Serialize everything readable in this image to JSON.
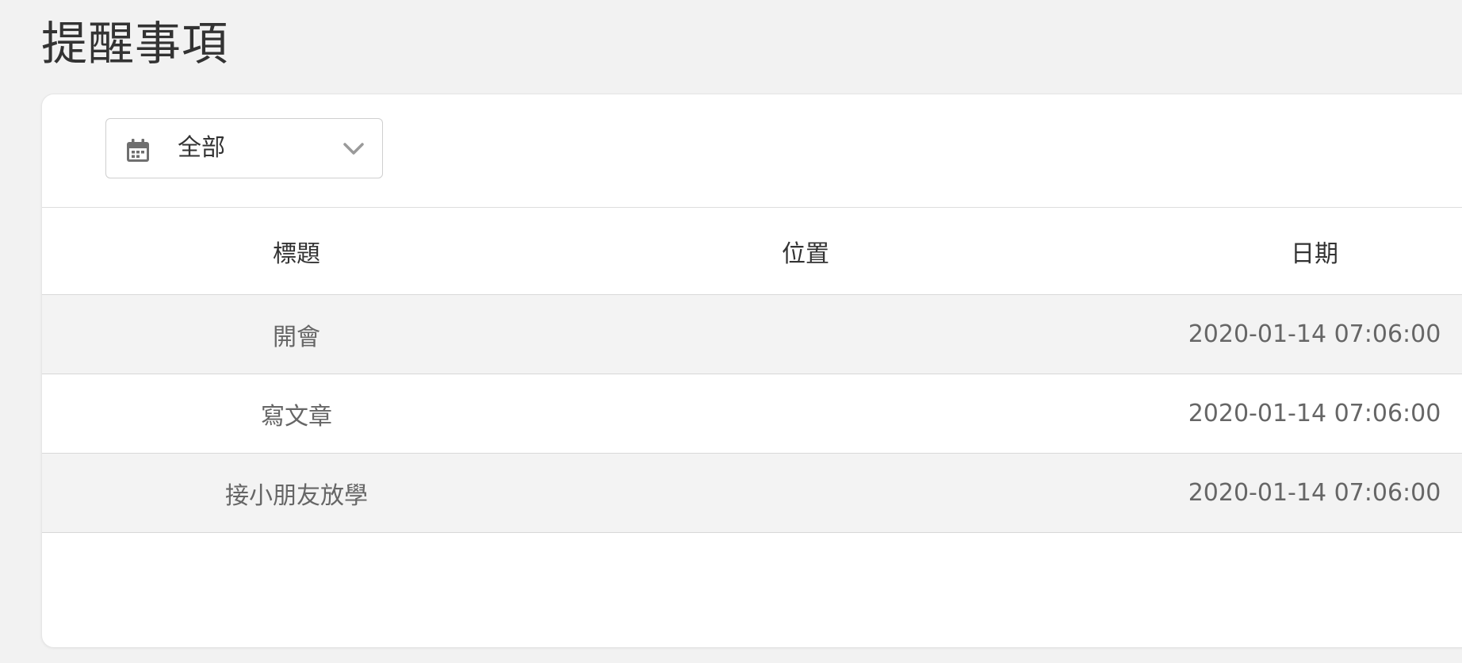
{
  "page": {
    "title": "提醒事項"
  },
  "filter": {
    "selected": "全部",
    "icon": "calendar-icon"
  },
  "table": {
    "columns": [
      "標題",
      "位置",
      "日期"
    ],
    "rows": [
      {
        "title": "開會",
        "location": "",
        "date": "2020-01-14 07:06:00"
      },
      {
        "title": "寫文章",
        "location": "",
        "date": "2020-01-14 07:06:00"
      },
      {
        "title": "接小朋友放學",
        "location": "",
        "date": "2020-01-14 07:06:00"
      }
    ]
  },
  "colors": {
    "background": "#f2f2f2",
    "card": "#ffffff",
    "stripe": "#f3f3f3",
    "text_dark": "#333333",
    "text_muted": "#666666"
  }
}
